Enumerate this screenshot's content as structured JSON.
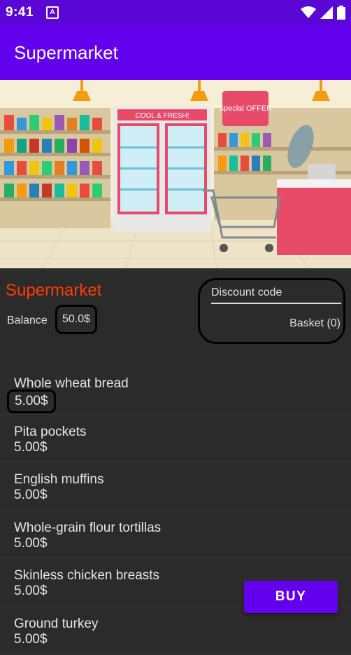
{
  "status_bar": {
    "time": "9:41",
    "notification_glyph": "A",
    "icons": [
      "wifi-icon",
      "signal-icon",
      "battery-icon"
    ]
  },
  "app_bar": {
    "title": "Supermarket"
  },
  "store": {
    "title": "Supermarket",
    "balance_label": "Balance",
    "balance_value": "50.0$",
    "discount_placeholder": "Discount code",
    "basket_label": "Basket (0)"
  },
  "products": [
    {
      "name": "Whole wheat bread",
      "price": "5.00$"
    },
    {
      "name": "Pita pockets",
      "price": "5.00$"
    },
    {
      "name": "English muffins",
      "price": "5.00$"
    },
    {
      "name": "Whole-grain flour tortillas",
      "price": "5.00$"
    },
    {
      "name": "Skinless chicken breasts",
      "price": "5.00$"
    },
    {
      "name": "Ground turkey",
      "price": "5.00$"
    }
  ],
  "buy_button": {
    "label": "BUY"
  },
  "hero_image": {
    "sign_text": "COOL & FRESH!",
    "special_text": "Special OFFER"
  },
  "colors": {
    "primary": "#6200ee",
    "status_bar": "#5a06d4",
    "accent": "#ff3d00",
    "background": "#2b2b2b"
  }
}
